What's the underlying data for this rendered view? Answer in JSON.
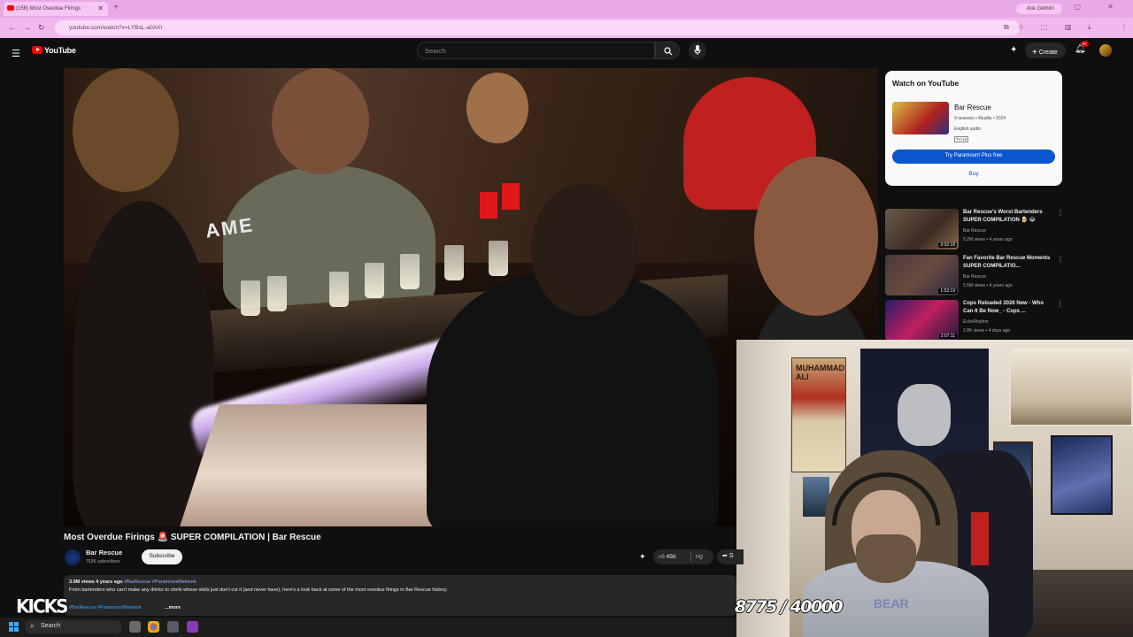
{
  "browser": {
    "tab_title": "(158) Most Overdue Firings",
    "new_tab": "+",
    "ask_gemini": "Ask Gemini",
    "window_controls": "– ▢ ✕",
    "url": "youtube.com/watch?v=LYBsL-a0AXI"
  },
  "header": {
    "logo": "YouTube",
    "search_placeholder": "Search",
    "create_label": "Create",
    "notification_count": "9+"
  },
  "player": {
    "overlay_sign": "AME"
  },
  "watch_panel": {
    "title": "Watch on YouTube",
    "show_name": "Bar Rescue",
    "show_meta": "9 seasons • Reality • 2024",
    "audio": "English audio",
    "rating": "TV-14",
    "plus_button": "Try Paramount Plus free",
    "buy_button": "Buy"
  },
  "recommendations": [
    {
      "title": "Bar Rescue's Worst Bartenders SUPER COMPILATION 🍺 😂",
      "channel": "Bar Rescue",
      "meta": "5.2M views • 4 years ago",
      "duration": "2:02:18",
      "color": "#4a3a32"
    },
    {
      "title": "Fan Favorite Bar Rescue Moments SUPER COMPILATIO...",
      "channel": "Bar Rescue",
      "meta": "5.5M views • 4 years ago",
      "duration": "1:53:19",
      "color": "#5a3a3a"
    },
    {
      "title": "Cops Reloaded 2026 New - Who Can It Be Now_ - Cops ...",
      "channel": "EchoRhythm",
      "meta": "2.8K views • 4 days ago",
      "duration": "2:07:11",
      "color": "#3a2a6a"
    }
  ],
  "video": {
    "title_part1": "Most Overdue Firings",
    "title_emoji": "🚨",
    "title_part2": "SUPER COMPILATION | Bar Rescue",
    "channel": "Bar Rescue",
    "subscribers": "753K subscribers",
    "subscribe_label": "Subscribe",
    "likes": "45K",
    "share_label": "S",
    "stats": "3.9M views  4 years ago",
    "hashtags": "#BarRescue #ParamountNetwork",
    "description": "From bartenders who can't make any drinks to chefs whose skills just don't cut it (and never have), here's a look back at some of the most overdue firings in Bar Rescue history.",
    "desc_hashtags": "#BarRescue #ParamountNetwork",
    "more_label": "...more"
  },
  "webcam": {
    "poster_text": "MUHAMMAD ALI",
    "hoodie_text": "BEAR"
  },
  "overlays": {
    "left": "KICKS",
    "right": "8775 / 40000"
  },
  "taskbar": {
    "search_label": "Search"
  }
}
